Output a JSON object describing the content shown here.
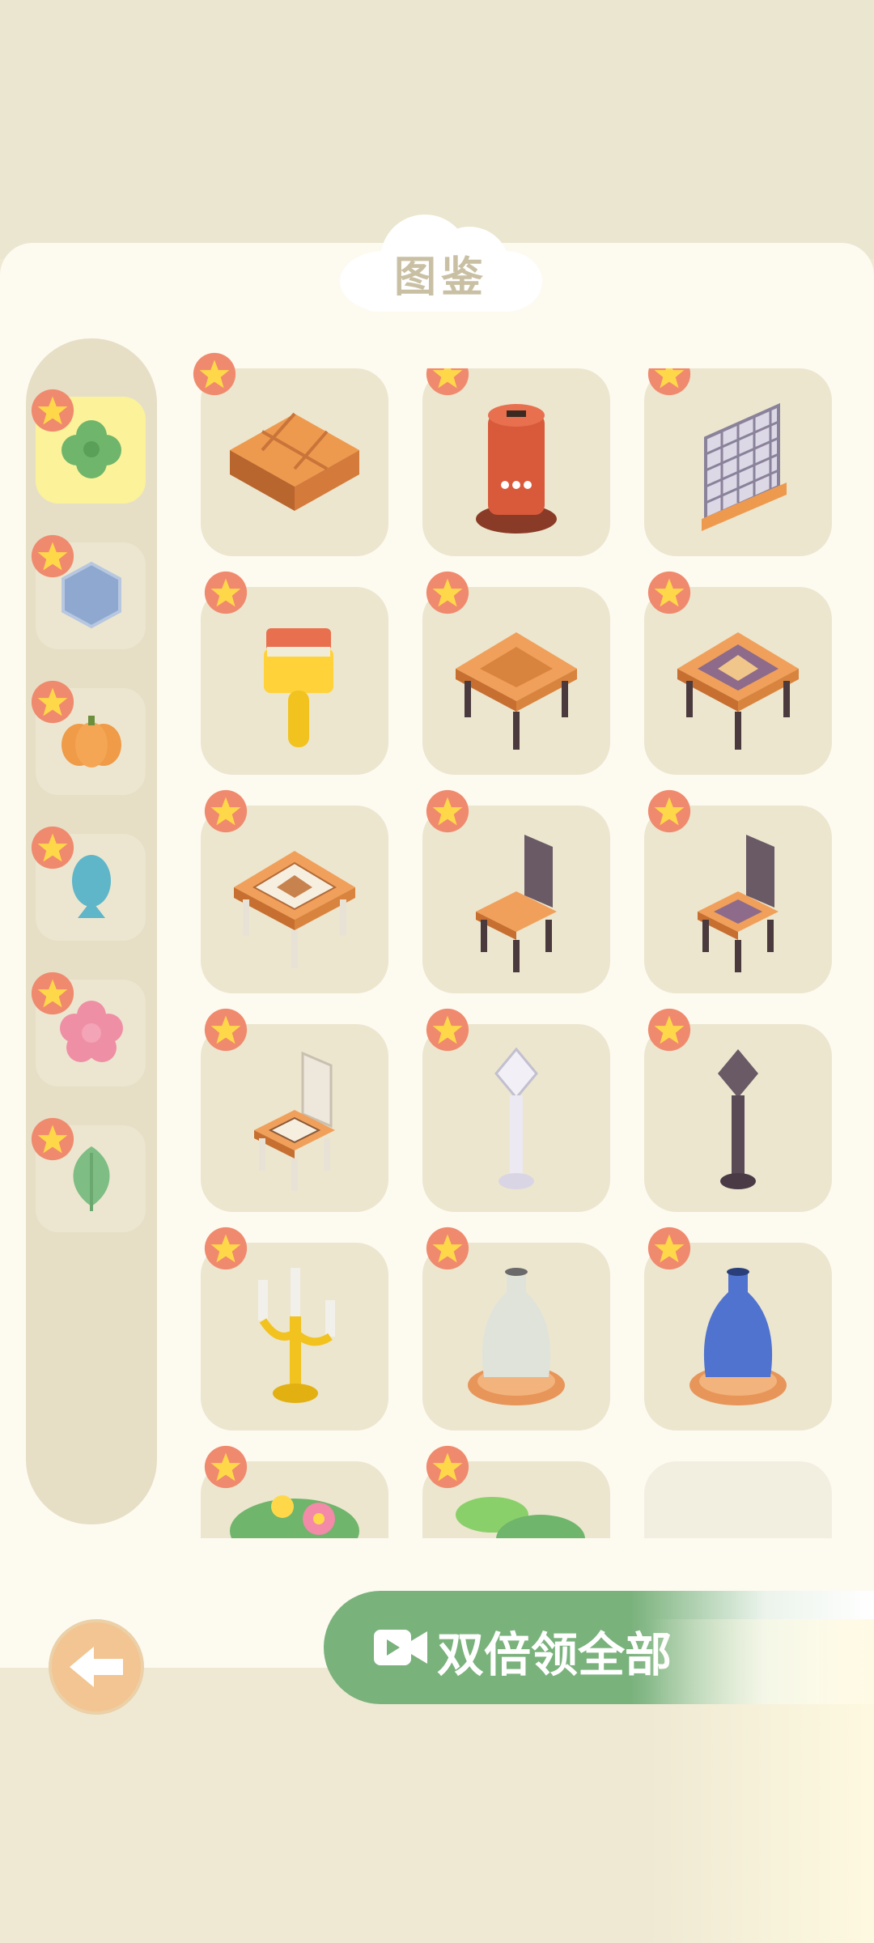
{
  "header": {
    "title": "图鉴"
  },
  "sidebar": {
    "categories": [
      {
        "icon": "clover-icon",
        "active": true
      },
      {
        "icon": "hexagon-icon",
        "active": false
      },
      {
        "icon": "pumpkin-icon",
        "active": false
      },
      {
        "icon": "fish-icon",
        "active": false
      },
      {
        "icon": "flower-icon",
        "active": false
      },
      {
        "icon": "leaf-icon",
        "active": false
      }
    ]
  },
  "collection": {
    "items": [
      {
        "icon": "brick-floor-icon"
      },
      {
        "icon": "mailbox-icon"
      },
      {
        "icon": "lattice-fence-icon"
      },
      {
        "icon": "paint-brush-icon"
      },
      {
        "icon": "wooden-table-icon"
      },
      {
        "icon": "patterned-table-icon"
      },
      {
        "icon": "white-patterned-table-icon"
      },
      {
        "icon": "dark-chair-icon"
      },
      {
        "icon": "patterned-chair-icon"
      },
      {
        "icon": "white-chair-icon"
      },
      {
        "icon": "white-lamp-post-icon"
      },
      {
        "icon": "dark-lamp-post-icon"
      },
      {
        "icon": "candelabra-icon"
      },
      {
        "icon": "white-vase-icon"
      },
      {
        "icon": "blue-vase-icon"
      },
      {
        "icon": "flower-bed-icon"
      },
      {
        "icon": "lily-pad-icon"
      }
    ]
  },
  "footer": {
    "back_icon": "arrow-left-icon",
    "double_claim_label": "双倍领全部",
    "video_icon": "video-camera-icon"
  },
  "colors": {
    "accent_green": "#7ab27c",
    "badge_red": "#f08a6e",
    "badge_star": "#ffd84a",
    "tile_bg": "#ece6cf",
    "active_category": "#fbf29a"
  }
}
